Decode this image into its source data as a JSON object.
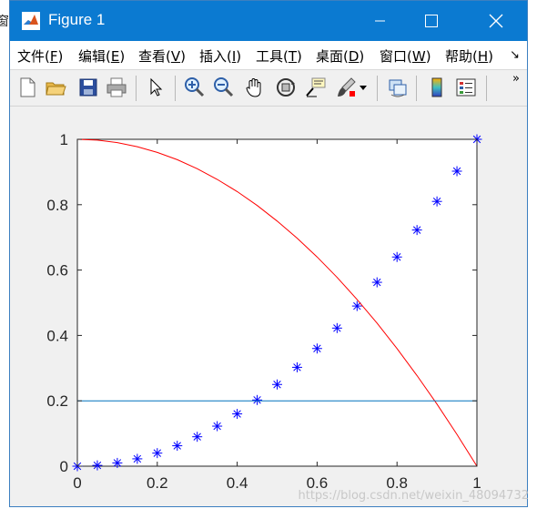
{
  "sidebar_fragment": {
    "char": "窗"
  },
  "window": {
    "title": "Figure 1"
  },
  "menu": {
    "items": [
      {
        "label": "文件(",
        "key": "F",
        "tail": ")"
      },
      {
        "label": "编辑(",
        "key": "E",
        "tail": ")"
      },
      {
        "label": "查看(",
        "key": "V",
        "tail": ")"
      },
      {
        "label": "插入(",
        "key": "I",
        "tail": ")"
      },
      {
        "label": "工具(",
        "key": "T",
        "tail": ")"
      },
      {
        "label": "桌面(",
        "key": "D",
        "tail": ")"
      },
      {
        "label": "窗口(",
        "key": "W",
        "tail": ")"
      },
      {
        "label": "帮助(",
        "key": "H",
        "tail": ")"
      }
    ],
    "more": "↘"
  },
  "toolbar": {
    "icons": [
      "new-figure-icon",
      "open-file-icon",
      "save-icon",
      "print-icon",
      "pointer-icon",
      "zoom-in-icon",
      "zoom-out-icon",
      "pan-hand-icon",
      "rotate-3d-icon",
      "data-cursor-icon",
      "brush-icon",
      "link-plot-icon",
      "colorbar-icon",
      "legend-icon"
    ],
    "more": "»"
  },
  "watermark": "https://blog.csdn.net/weixin_48094732",
  "chart_data": {
    "type": "line",
    "xlim": [
      0,
      1
    ],
    "ylim": [
      0,
      1
    ],
    "xticks": [
      "0",
      "0.2",
      "0.4",
      "0.6",
      "0.8",
      "1"
    ],
    "yticks": [
      "0",
      "0.2",
      "0.4",
      "0.6",
      "0.8",
      "1"
    ],
    "grid": false,
    "series": [
      {
        "style": "marker-star",
        "color": "#0000ff",
        "x": [
          0,
          0.05,
          0.1,
          0.15,
          0.2,
          0.25,
          0.3,
          0.35,
          0.4,
          0.45,
          0.5,
          0.55,
          0.6,
          0.65,
          0.7,
          0.75,
          0.8,
          0.85,
          0.9,
          0.95,
          1.0
        ],
        "y": [
          0,
          0.0025,
          0.01,
          0.0225,
          0.04,
          0.0625,
          0.09,
          0.1225,
          0.16,
          0.2025,
          0.25,
          0.3025,
          0.36,
          0.4225,
          0.49,
          0.5625,
          0.64,
          0.7225,
          0.81,
          0.9025,
          1.0
        ]
      },
      {
        "style": "line",
        "color": "#ff0000",
        "x": [
          0,
          0.05,
          0.1,
          0.15,
          0.2,
          0.25,
          0.3,
          0.35,
          0.4,
          0.45,
          0.5,
          0.55,
          0.6,
          0.65,
          0.7,
          0.75,
          0.8,
          0.85,
          0.9,
          0.95,
          1.0
        ],
        "y": [
          1,
          0.9975,
          0.99,
          0.9775,
          0.96,
          0.9375,
          0.91,
          0.8775,
          0.84,
          0.7975,
          0.75,
          0.6975,
          0.64,
          0.5775,
          0.51,
          0.4375,
          0.36,
          0.2775,
          0.19,
          0.0975,
          0
        ]
      },
      {
        "style": "line",
        "color": "#0072bd",
        "x": [
          0,
          1
        ],
        "y": [
          0.2,
          0.2
        ]
      }
    ]
  }
}
